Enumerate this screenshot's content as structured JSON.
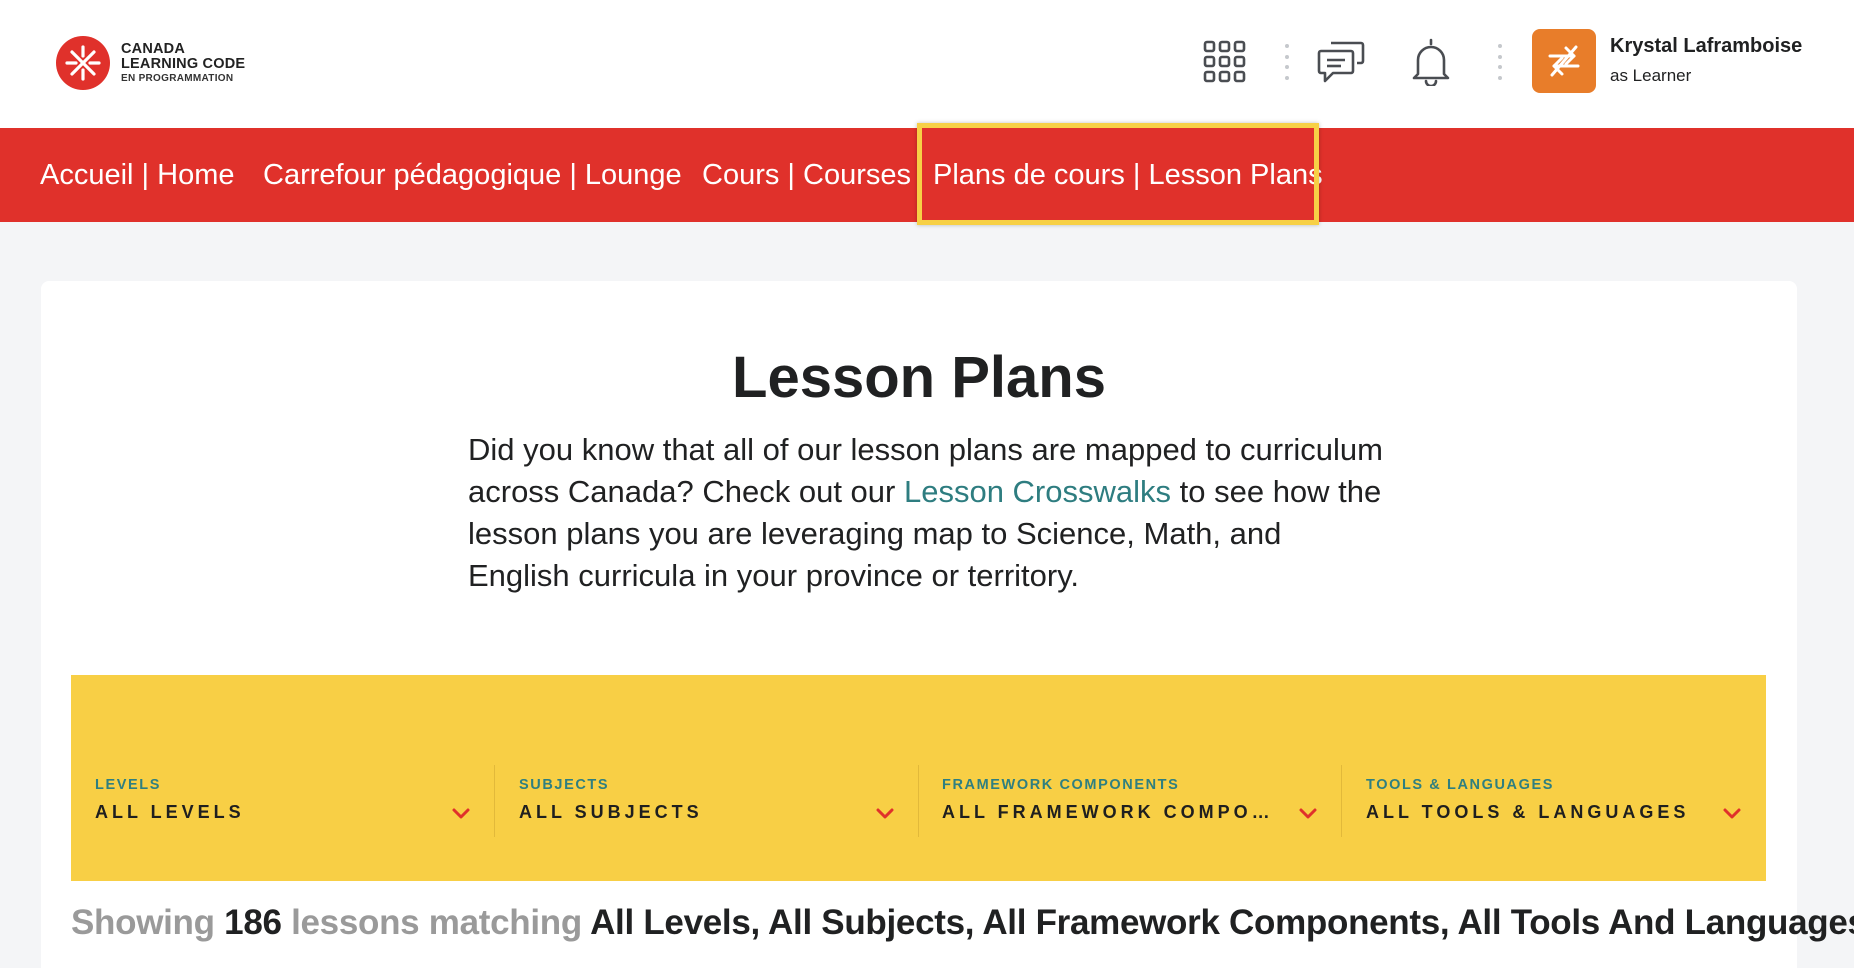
{
  "logo": {
    "line1": "CANADA",
    "line2": "LEARNING CODE",
    "line3": "EN PROGRAMMATION",
    "brand_color": "#e0312b"
  },
  "header": {
    "icons": [
      "app-grid-icon",
      "message-icon",
      "bell-icon"
    ],
    "user": {
      "name": "Krystal Laframboise",
      "role": "as Learner",
      "avatar_icon": "switch-arrows-icon",
      "avatar_color": "#e87d2a"
    }
  },
  "nav": {
    "items": [
      {
        "label": "Accueil | Home"
      },
      {
        "label": "Carrefour pédagogique | Lounge"
      },
      {
        "label": "Cours | Courses"
      },
      {
        "label": "Plans de cours | Lesson Plans",
        "highlighted": true
      }
    ],
    "highlight_color": "#f7d046"
  },
  "main": {
    "title": "Lesson Plans",
    "intro_before_link": "Did you know that all of our lesson plans are mapped to curriculum across Canada? Check out our ",
    "intro_link": "Lesson Crosswalks",
    "intro_after_link": " to see how the lesson plans you are leveraging map to Science, Math, and English curricula in your province or territory."
  },
  "filters": [
    {
      "label": "LEVELS",
      "value": "ALL LEVELS"
    },
    {
      "label": "SUBJECTS",
      "value": "ALL SUBJECTS"
    },
    {
      "label": "FRAMEWORK COMPONENTS",
      "value": "ALL FRAMEWORK COMPO…"
    },
    {
      "label": "TOOLS & LANGUAGES",
      "value": "ALL TOOLS & LANGUAGES"
    }
  ],
  "results": {
    "prefix": "Showing",
    "count": "186",
    "middle": "lessons matching",
    "criteria": "All Levels, All Subjects, All Framework Components, All Tools And Languages"
  },
  "colors": {
    "nav_bg": "#e0312b",
    "filter_bg": "#f8cf45",
    "filter_label": "#2f7f80",
    "link": "#2e7d80",
    "chevron": "#e0312b"
  }
}
